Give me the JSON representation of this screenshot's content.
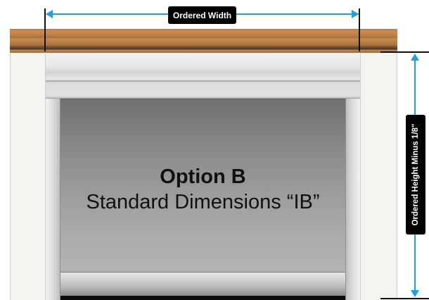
{
  "dimensions": {
    "width_label": "Ordered Width",
    "height_label": "Ordered Height Minus 1/8\""
  },
  "shade": {
    "option_title": "Option B",
    "option_subtitle": "Standard Dimensions “IB”"
  },
  "colors": {
    "dimension_arrow": "#1da1dc",
    "label_background": "#000000",
    "wood": "#b57c44"
  }
}
